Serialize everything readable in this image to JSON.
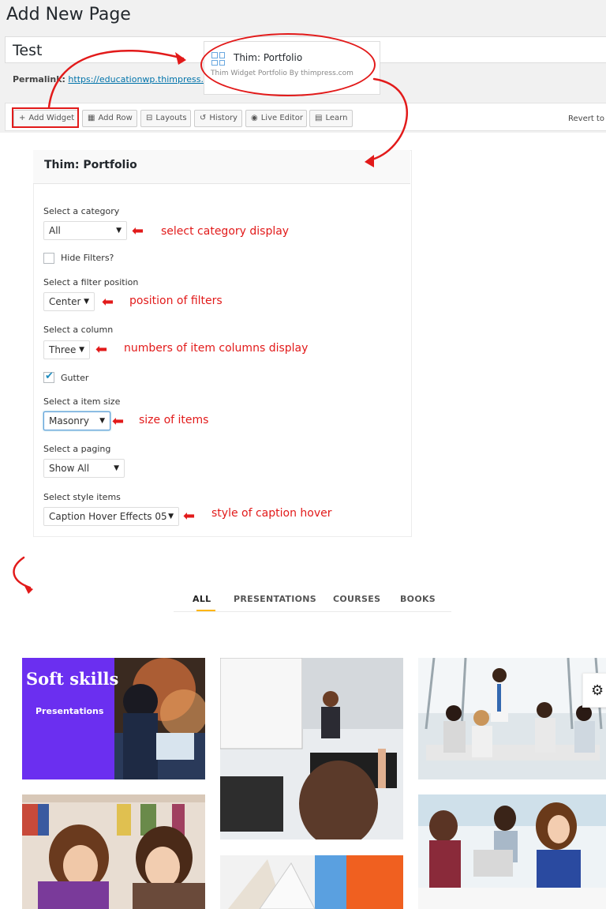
{
  "page": {
    "title": "Add New Page",
    "post_title_value": "Test",
    "permalink_label": "Permalink:",
    "permalink_url": "https://educationwp.thimpress."
  },
  "toolbar": {
    "add_widget": "Add Widget",
    "add_row": "Add Row",
    "layouts": "Layouts",
    "history": "History",
    "live_editor": "Live Editor",
    "learn": "Learn",
    "revert": "Revert to E"
  },
  "widget_popup": {
    "title": "Thim: Portfolio",
    "subtitle": "Thim Widget Portfolio By thimpress.com"
  },
  "panel": {
    "title": "Thim: Portfolio",
    "category_label": "Select a category",
    "category_value": "All",
    "hide_filters_label": "Hide Filters?",
    "hide_filters_checked": false,
    "filter_position_label": "Select a filter position",
    "filter_position_value": "Center",
    "column_label": "Select a column",
    "column_value": "Three",
    "gutter_label": "Gutter",
    "gutter_checked": true,
    "item_size_label": "Select a item size",
    "item_size_value": "Masonry",
    "paging_label": "Select a paging",
    "paging_value": "Show All",
    "style_label": "Select style items",
    "style_value": "Caption Hover Effects 05"
  },
  "annotations": {
    "category": "select category display",
    "filters": "position of filters",
    "columns": "numbers of item columns display",
    "size": "size of items",
    "hover": "style of caption hover"
  },
  "portfolio": {
    "filters": [
      "ALL",
      "PRESENTATIONS",
      "COURSES",
      "BOOKS"
    ],
    "active_filter": "ALL",
    "card_title": "Soft skills",
    "card_subtitle": "Presentations"
  },
  "colors": {
    "accent_red": "#e21a1a",
    "filter_underline": "#ffb606",
    "card_purple": "#6b2ff0",
    "link_blue": "#0073aa"
  },
  "icons": {
    "add_widget": "plus-icon",
    "add_row": "grid-icon",
    "layouts": "layouts-icon",
    "history": "history-icon",
    "live_editor": "eye-icon",
    "learn": "film-icon",
    "settings": "gear-icon"
  }
}
